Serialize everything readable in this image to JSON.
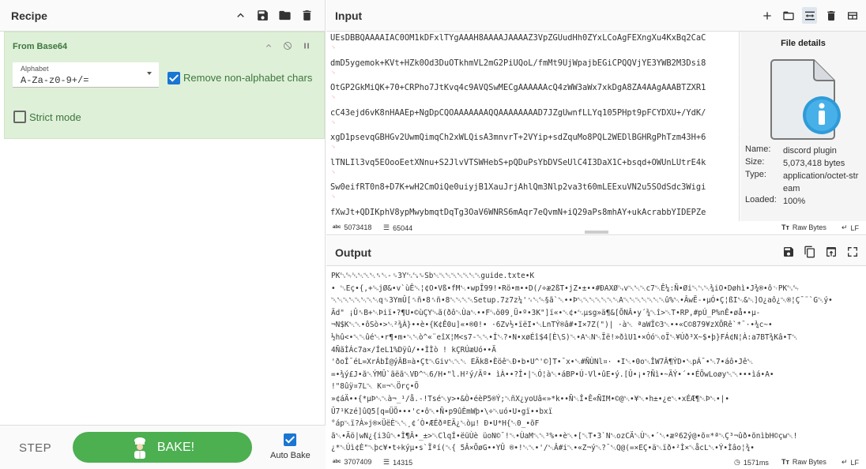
{
  "recipe": {
    "title": "Recipe",
    "icons": [
      "chevron-up-icon",
      "save-icon",
      "folder-icon",
      "trash-icon"
    ],
    "operation": {
      "name": "From Base64",
      "alphabet_label": "Alphabet",
      "alphabet_value": "A-Za-z0-9+/=",
      "remove_non_alpha_label": "Remove non-alphabet chars",
      "remove_non_alpha_checked": true,
      "strict_mode_label": "Strict mode",
      "strict_mode_checked": false
    },
    "footer": {
      "step_label": "STEP",
      "bake_label": "BAKE!",
      "autobake_label": "Auto Bake",
      "autobake_checked": true
    }
  },
  "input": {
    "title": "Input",
    "lines": [
      "UEsDBBQAAAAIAC0OM1kDFxlTYgAAAH8AAAAJAAAAZ3VpZGUudHh0ZYxLCoAgFEXngXu4KxBq2CaC",
      "dmD5ygemok+KVt+HZk0Od3DuOTkhmVL2mG2PiUQoL/fmMt9UjWpajbEGiCPQQVjYE3YWB2M3Dsi8",
      "OtGP2GkMiQK+70+CRPho7JtKvq4c9AVQSwMECgAAAAAAcQ4zWW3aWx7xkDgA8ZA4AAgAAABTZXR1",
      "cC43ejd6vK8nHAAEp+NgDpCQOAAAAAAAQQAAAAAAAAD7JZgUwnfLLYq105PHpt9pFCYDXU+/YdK/",
      "xgD1psevqGBHGv2UwmQimqCh2xWLQisA3mnvrT+2VYip+sdZquMo8PQL2WEDlBGHRgPhTzm43H+6",
      "lTNLIl3vq5EOooEetXNnu+S2JlvVTSWHebS+pQDuPsYbDVSeUlC4I3DaX1C+bsqd+OWUnLUtrE4k",
      "Sw0eifRT0n8+D7K+wH2CmOiQe0uiyjB1XauJrjAhlQm3Nlp2va3t60mLEExuVN2u5SOdSdc3Wigi",
      "fXwJt+QDIKphV8ypMwybmqtDqTg3OaV6WNRS6mAqr7eQvmN+iQ29aPs8mhAY+ukAcrabbYIDEPZe"
    ],
    "file_details": {
      "title": "File details",
      "name_label": "Name:",
      "name_value": "discord plugin",
      "size_label": "Size:",
      "size_value": "5,073,418 bytes",
      "type_label": "Type:",
      "type_value": "application/octet-stream",
      "loaded_label": "Loaded:",
      "loaded_value": "100%"
    },
    "status": {
      "length_label": "abc",
      "length": "5073418",
      "lines_label": "",
      "lines": "65044",
      "format": "Raw Bytes",
      "eol": "LF"
    }
  },
  "output": {
    "title": "Output",
    "lines": [
      "PK␃␄␔␀␀␀␈␀-␎3Y␃␗␙Sb␀␀␀␀␀␀␀␀guide.txte•K",
      "• ␂Eç•{,+␁jØ&•v`ùÊ␆¦¢O•Vß•fM␀•wpÎ99!•Rö•m••D(/÷æ2ßT•jZ•±••#ÐAXØ␐v␀␀␀c7␀Ê¼:Ñ•Øi␀␂␀¾iO•Døhì•J¾®•ô␋PK␃␄",
      "␀␀␀␀␀␀␀␀q␎3YmÛ[␞ñ•8␞ñ•8␀␀␀␀Setup.7z7z¼'␜␀␄§ã`␀••Þ␀␀␀␀␀␀␀A␀␀␀␀␀␀␀û%␀•ÂwË-•µÓ•Ç¦ßI␀&␀]O¿aô¿␀®¦Ç¯¨`G␀ý•",
      "Äd\" ¡Û␈B+␀Þiï•?¶U•©ùÇY␁ã(ðô␀Ùa␀••F␐ö09¸Ü•º•3K\"]ï«•␀¢•␃µsg»ä¶&[ÕNÂ•y´¾␀î>␀T•RP,#pÚ_P%nÊ•øå••µ-",
      "¬N$K␀␀•ôSò•>␀²¾À}••è•{K¢Ê0u]«•®0!•  ·6Zv½•ïëI•␀LnTÝ®â#•I×7Z(\")| ·à␀ ªaWÏ©3␀••«C©879¥zXÕRê`*¯·•¾c~•",
      "½hû<•␀␀ûé␀•r¶•m•␀␀ò^«¨eîX¦M<s7-␀␀•Í␀?•N•xøÉî$4[È\\S)␀•A␀N␀Ïë!»ðìU1•×Óó␀oÏ␀¥Úð³X~$•þ}FÁ¢N¦À:a7BT¾Kâ•T␀",
      "4ÑãÌÁc7a×/ÍeL1%Dÿû/••ÌÌò    ! kÇRÚæUó••Ã",
      "'ðoÎ¯éL=XrÁbÍ@ýÂB¤à•Çt␀Giv␀␀␀  EÄk8•Èöê␀Ð•b•U^'©]T•¯x•␀#ÑÙNl¤·  •I␀•0o␀ÎW7Â¶ÝD•␀pÁ¯•␀7•áô•Jê␀",
      "=•¾ý£J•ã␀ÝMÛ`ãëã␀VÐ^␀6/H•\"l.H²ý/Äº• ìÀ••?Î•|␀Ó¦à␀•áBP•Ú-Vl•ûE•ý.[Û•¡•?Ñì•~ÄÝ•´••ÉÕwLoøy␀␀•••ìá•A•",
      "!\"8ûÿ¤7L␀ K¤¬␀Örç•Õ",
      "»¢áÄ••{*µÞ␀␀à¬_¹/å.-!Tsé␀y>•&Ò•éèP5®Ý;␀ñX¿yoUâ«»*k••Ñ␀Î•Ê«ÑIM•©@␀•¥␀•h±•¿e␀•xÉÆ¶␀Þ␀•|•",
      "Û7¹Kzé]ûQ5[q=ÜÖ•••'c•ô␀•Ñ•p9ûÈmWþ•\\÷␀uó•U•gï••bxï",
      "°áp␀ï?À»j®×ÜëÈ␀␀¸¢´Ò•ÆÉðªEÄ¿␀òµ! Ð•U*H{␀0_•õF",
      "ã␀•Äö|wN¿{i3û␀•Ì¶Â•_±>␀ClqÍ•ëüÙè üoN©¯!␀•ÙaM␀␀³%••è␀•[␀T•3`N␀ozCÄ␀Ù␀•´␀•æº62ý@•õ¤*ª␀Ç³¬ûð•õnìbH©çw␀!",
      "¿*␀Úì¢È\"␀þc¥•t÷kýµ•s`Ïªí(␀{ 5Â×ÕøG••YÛ ®•!␀␀•'/␀Â#i␀•«Z¬ý␀?¯␀Q@(=×EÇ•ä␀ïð•²Ì×␀åcL␀•Ý•Ìâo¦¾•"
    ],
    "status": {
      "length_label": "abc",
      "length": "3707409",
      "lines_label": "",
      "lines": "14315",
      "time": "1571ms",
      "format": "Raw Bytes",
      "eol": "LF"
    }
  }
}
